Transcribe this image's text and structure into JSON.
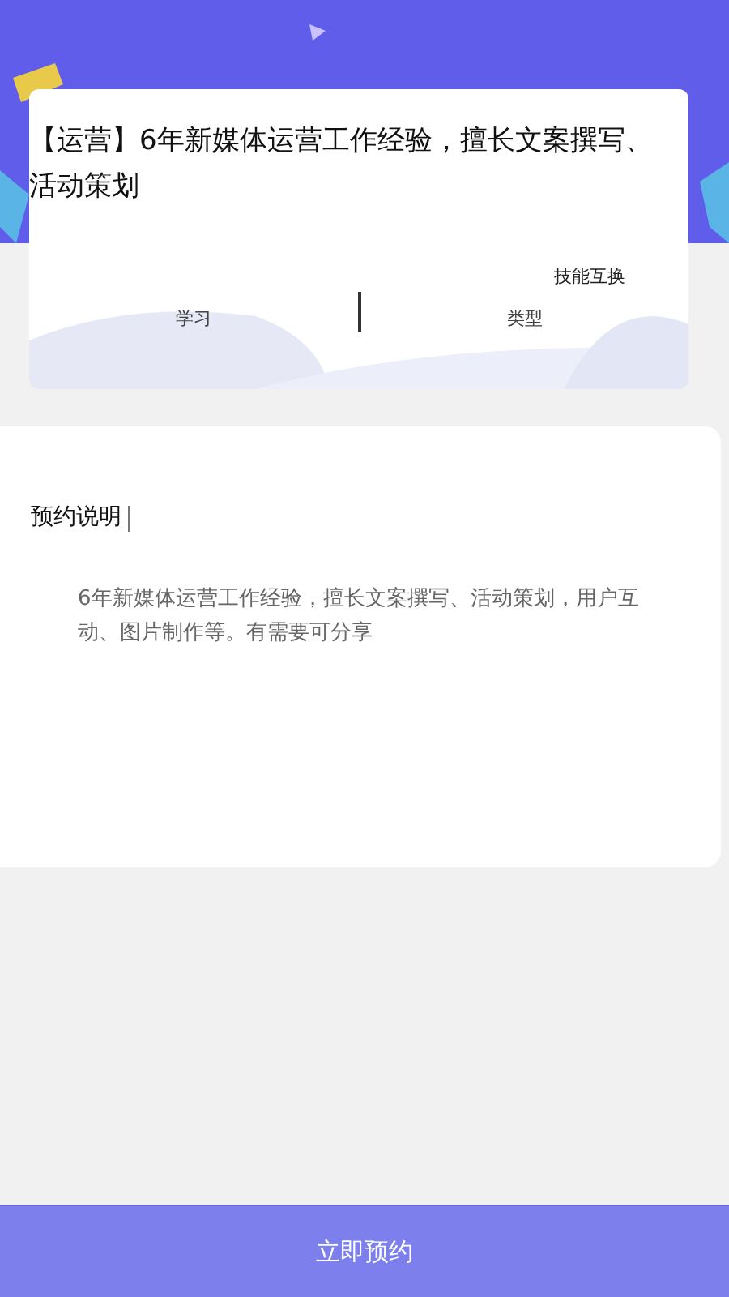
{
  "skill_card": {
    "title": "【运营】6年新媒体运营工作经验，擅长文案撰写、活动策划",
    "columns": [
      {
        "label": "学习"
      },
      {
        "value": "技能互换",
        "label": "类型"
      }
    ]
  },
  "description": {
    "heading": "预约说明",
    "body": "6年新媒体运营工作经验，擅长文案撰写、活动策划，用户互动、图片制作等。有需要可分享"
  },
  "action_button": {
    "label": "立即预约"
  }
}
